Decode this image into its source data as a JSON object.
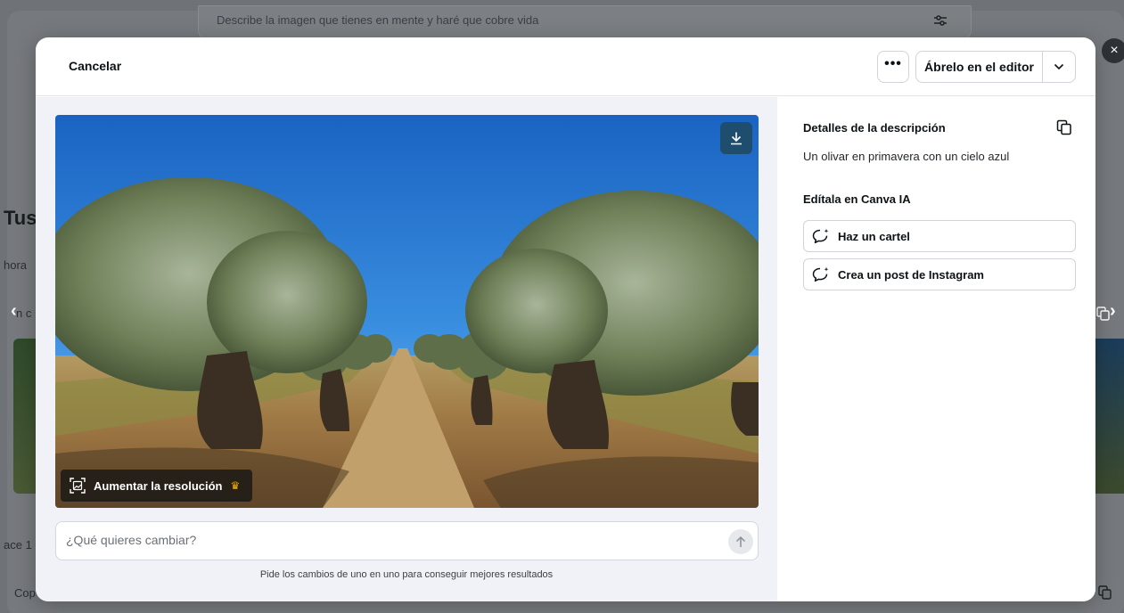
{
  "background": {
    "prompt_text": "Describe la imagen que tienes en mente y haré que cobre vida",
    "title_fragment": "Tus",
    "sub_fragment": "hora",
    "chip_fragment": "n c",
    "ago_fragment": "ace 1",
    "copy_fragment": "Cop",
    "arrow_left": "‹",
    "arrow_right": "›"
  },
  "close": {
    "icon": "close-icon",
    "label": "×"
  },
  "header": {
    "cancel_label": "Cancelar",
    "more_label": "•••",
    "open_editor_label": "Ábrelo en el editor"
  },
  "image": {
    "upscale_label": "Aumentar la resolución",
    "crown": "♛"
  },
  "change": {
    "placeholder": "¿Qué quieres cambiar?",
    "hint": "Pide los cambios de uno en uno para conseguir mejores resultados"
  },
  "details": {
    "title": "Detalles de la descripción",
    "description": "Un olivar en primavera con un cielo azul",
    "edit_title": "Edítala en Canva IA",
    "actions": [
      {
        "label": "Haz un cartel",
        "icon": "ai-chat-icon"
      },
      {
        "label": "Crea un post de Instagram",
        "icon": "ai-chat-icon"
      }
    ]
  },
  "colors": {
    "accent_download": "#1f4d6e",
    "overlay": "#6f7377",
    "sky": "#1f6fc9"
  }
}
